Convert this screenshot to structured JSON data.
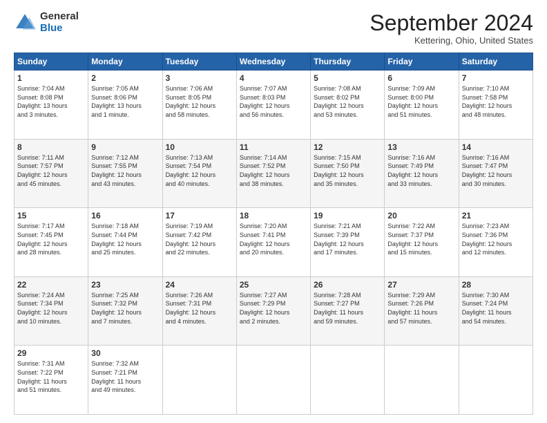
{
  "logo": {
    "general": "General",
    "blue": "Blue"
  },
  "title": "September 2024",
  "subtitle": "Kettering, Ohio, United States",
  "days_header": [
    "Sunday",
    "Monday",
    "Tuesday",
    "Wednesday",
    "Thursday",
    "Friday",
    "Saturday"
  ],
  "weeks": [
    [
      {
        "day": "1",
        "info": "Sunrise: 7:04 AM\nSunset: 8:08 PM\nDaylight: 13 hours\nand 3 minutes."
      },
      {
        "day": "2",
        "info": "Sunrise: 7:05 AM\nSunset: 8:06 PM\nDaylight: 13 hours\nand 1 minute."
      },
      {
        "day": "3",
        "info": "Sunrise: 7:06 AM\nSunset: 8:05 PM\nDaylight: 12 hours\nand 58 minutes."
      },
      {
        "day": "4",
        "info": "Sunrise: 7:07 AM\nSunset: 8:03 PM\nDaylight: 12 hours\nand 56 minutes."
      },
      {
        "day": "5",
        "info": "Sunrise: 7:08 AM\nSunset: 8:02 PM\nDaylight: 12 hours\nand 53 minutes."
      },
      {
        "day": "6",
        "info": "Sunrise: 7:09 AM\nSunset: 8:00 PM\nDaylight: 12 hours\nand 51 minutes."
      },
      {
        "day": "7",
        "info": "Sunrise: 7:10 AM\nSunset: 7:58 PM\nDaylight: 12 hours\nand 48 minutes."
      }
    ],
    [
      {
        "day": "8",
        "info": "Sunrise: 7:11 AM\nSunset: 7:57 PM\nDaylight: 12 hours\nand 45 minutes."
      },
      {
        "day": "9",
        "info": "Sunrise: 7:12 AM\nSunset: 7:55 PM\nDaylight: 12 hours\nand 43 minutes."
      },
      {
        "day": "10",
        "info": "Sunrise: 7:13 AM\nSunset: 7:54 PM\nDaylight: 12 hours\nand 40 minutes."
      },
      {
        "day": "11",
        "info": "Sunrise: 7:14 AM\nSunset: 7:52 PM\nDaylight: 12 hours\nand 38 minutes."
      },
      {
        "day": "12",
        "info": "Sunrise: 7:15 AM\nSunset: 7:50 PM\nDaylight: 12 hours\nand 35 minutes."
      },
      {
        "day": "13",
        "info": "Sunrise: 7:16 AM\nSunset: 7:49 PM\nDaylight: 12 hours\nand 33 minutes."
      },
      {
        "day": "14",
        "info": "Sunrise: 7:16 AM\nSunset: 7:47 PM\nDaylight: 12 hours\nand 30 minutes."
      }
    ],
    [
      {
        "day": "15",
        "info": "Sunrise: 7:17 AM\nSunset: 7:45 PM\nDaylight: 12 hours\nand 28 minutes."
      },
      {
        "day": "16",
        "info": "Sunrise: 7:18 AM\nSunset: 7:44 PM\nDaylight: 12 hours\nand 25 minutes."
      },
      {
        "day": "17",
        "info": "Sunrise: 7:19 AM\nSunset: 7:42 PM\nDaylight: 12 hours\nand 22 minutes."
      },
      {
        "day": "18",
        "info": "Sunrise: 7:20 AM\nSunset: 7:41 PM\nDaylight: 12 hours\nand 20 minutes."
      },
      {
        "day": "19",
        "info": "Sunrise: 7:21 AM\nSunset: 7:39 PM\nDaylight: 12 hours\nand 17 minutes."
      },
      {
        "day": "20",
        "info": "Sunrise: 7:22 AM\nSunset: 7:37 PM\nDaylight: 12 hours\nand 15 minutes."
      },
      {
        "day": "21",
        "info": "Sunrise: 7:23 AM\nSunset: 7:36 PM\nDaylight: 12 hours\nand 12 minutes."
      }
    ],
    [
      {
        "day": "22",
        "info": "Sunrise: 7:24 AM\nSunset: 7:34 PM\nDaylight: 12 hours\nand 10 minutes."
      },
      {
        "day": "23",
        "info": "Sunrise: 7:25 AM\nSunset: 7:32 PM\nDaylight: 12 hours\nand 7 minutes."
      },
      {
        "day": "24",
        "info": "Sunrise: 7:26 AM\nSunset: 7:31 PM\nDaylight: 12 hours\nand 4 minutes."
      },
      {
        "day": "25",
        "info": "Sunrise: 7:27 AM\nSunset: 7:29 PM\nDaylight: 12 hours\nand 2 minutes."
      },
      {
        "day": "26",
        "info": "Sunrise: 7:28 AM\nSunset: 7:27 PM\nDaylight: 11 hours\nand 59 minutes."
      },
      {
        "day": "27",
        "info": "Sunrise: 7:29 AM\nSunset: 7:26 PM\nDaylight: 11 hours\nand 57 minutes."
      },
      {
        "day": "28",
        "info": "Sunrise: 7:30 AM\nSunset: 7:24 PM\nDaylight: 11 hours\nand 54 minutes."
      }
    ],
    [
      {
        "day": "29",
        "info": "Sunrise: 7:31 AM\nSunset: 7:22 PM\nDaylight: 11 hours\nand 51 minutes."
      },
      {
        "day": "30",
        "info": "Sunrise: 7:32 AM\nSunset: 7:21 PM\nDaylight: 11 hours\nand 49 minutes."
      },
      null,
      null,
      null,
      null,
      null
    ]
  ]
}
